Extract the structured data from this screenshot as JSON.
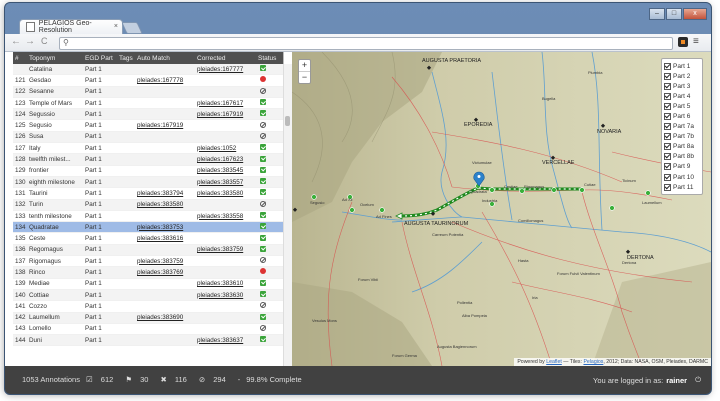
{
  "browser": {
    "tab_title": "PELAGIOS Geo-Resolution",
    "tab_close": "×",
    "back": "←",
    "forward": "→",
    "reload": "C",
    "min": "–",
    "max": "□",
    "close": "x",
    "menu": "≡"
  },
  "table": {
    "headers": [
      "#",
      "Toponym",
      "EGD Part",
      "Tags",
      "Auto Match",
      "Corrected",
      "Status"
    ],
    "rows": [
      {
        "num": "",
        "top": "Catalina",
        "egd": "Part 1",
        "auto": "",
        "corr": "pleiades:167777",
        "status": "ok",
        "style": "alt"
      },
      {
        "num": "121",
        "top": "Gesdao",
        "egd": "Part 1",
        "auto": "pleiades:167778",
        "corr": "",
        "status": "err",
        "style": ""
      },
      {
        "num": "122",
        "top": "Sesanne",
        "egd": "Part 1",
        "auto": "",
        "corr": "",
        "status": "no",
        "style": "alt"
      },
      {
        "num": "123",
        "top": "Temple of Mars",
        "egd": "Part 1",
        "auto": "",
        "corr": "pleiades:167617",
        "status": "ok",
        "style": ""
      },
      {
        "num": "124",
        "top": "Segussio",
        "egd": "Part 1",
        "auto": "",
        "corr": "pleiades:167919",
        "status": "ok",
        "style": "alt"
      },
      {
        "num": "125",
        "top": "Segusio",
        "egd": "Part 1",
        "auto": "pleiades:167919",
        "corr": "",
        "status": "no",
        "style": ""
      },
      {
        "num": "126",
        "top": "Susa",
        "egd": "Part 1",
        "auto": "",
        "corr": "",
        "status": "no",
        "style": "alt"
      },
      {
        "num": "127",
        "top": "Italy",
        "egd": "Part 1",
        "auto": "",
        "corr": "pleiades:1052",
        "status": "ok",
        "style": ""
      },
      {
        "num": "128",
        "top": "twelfth milest...",
        "egd": "Part 1",
        "auto": "",
        "corr": "pleiades:167623",
        "status": "ok",
        "style": "alt"
      },
      {
        "num": "129",
        "top": "frontier",
        "egd": "Part 1",
        "auto": "",
        "corr": "pleiades:383545",
        "status": "ok",
        "style": ""
      },
      {
        "num": "130",
        "top": "eighth milestone",
        "egd": "Part 1",
        "auto": "",
        "corr": "pleiades:383557",
        "status": "ok",
        "style": "alt"
      },
      {
        "num": "131",
        "top": "Taurini",
        "egd": "Part 1",
        "auto": "pleiades:383794",
        "corr": "pleiades:383580",
        "status": "ok",
        "style": ""
      },
      {
        "num": "132",
        "top": "Turin",
        "egd": "Part 1",
        "auto": "pleiades:383580",
        "corr": "",
        "status": "no",
        "style": "alt"
      },
      {
        "num": "133",
        "top": "tenth milestone",
        "egd": "Part 1",
        "auto": "",
        "corr": "pleiades:383558",
        "status": "ok",
        "style": ""
      },
      {
        "num": "134",
        "top": "Quadratae",
        "egd": "Part 1",
        "auto": "pleiades:383753",
        "corr": "",
        "status": "ok",
        "style": "sel"
      },
      {
        "num": "135",
        "top": "Ceste",
        "egd": "Part 1",
        "auto": "pleiades:383616",
        "corr": "",
        "status": "ok",
        "style": ""
      },
      {
        "num": "136",
        "top": "Regomagus",
        "egd": "Part 1",
        "auto": "",
        "corr": "pleiades:383759",
        "status": "ok",
        "style": "alt"
      },
      {
        "num": "137",
        "top": "Rigomagus",
        "egd": "Part 1",
        "auto": "pleiades:383759",
        "corr": "",
        "status": "no",
        "style": ""
      },
      {
        "num": "138",
        "top": "Rinco",
        "egd": "Part 1",
        "auto": "pleiades:383769",
        "corr": "",
        "status": "err",
        "style": "alt"
      },
      {
        "num": "139",
        "top": "Mediae",
        "egd": "Part 1",
        "auto": "",
        "corr": "pleiades:383610",
        "status": "ok",
        "style": ""
      },
      {
        "num": "140",
        "top": "Cottiae",
        "egd": "Part 1",
        "auto": "",
        "corr": "pleiades:383630",
        "status": "ok",
        "style": "alt"
      },
      {
        "num": "141",
        "top": "Cozzo",
        "egd": "Part 1",
        "auto": "",
        "corr": "",
        "status": "no",
        "style": ""
      },
      {
        "num": "142",
        "top": "Laumellum",
        "egd": "Part 1",
        "auto": "pleiades:383690",
        "corr": "",
        "status": "ok",
        "style": "alt"
      },
      {
        "num": "143",
        "top": "Lomello",
        "egd": "Part 1",
        "auto": "",
        "corr": "",
        "status": "no",
        "style": ""
      },
      {
        "num": "144",
        "top": "Duni",
        "egd": "Part 1",
        "auto": "",
        "corr": "pleiades:383637",
        "status": "ok",
        "style": "alt"
      }
    ]
  },
  "map": {
    "zoom_in": "+",
    "zoom_out": "−",
    "labels": [
      "AUGUSTA PRAETORIA",
      "EPOREDIA",
      "NOVARIA",
      "VERCELLAE",
      "AUGUSTA TAURINORUM",
      "DERTONA",
      "Ad Fines",
      "Quadrata",
      "Industria",
      "Rigomagus",
      "Cestiae",
      "Cutiae",
      "Carreum Potentia",
      "Forum Vibii",
      "Vesulus Mons",
      "Pollentia",
      "Hasta",
      "Plumbia",
      "Bugella",
      "Victumulae",
      "Laumellum",
      "Comillomagus",
      "Ad Xii",
      "Ocelum",
      "Segusio",
      "Forum Fulvii Valentinum",
      "Alba Pompeia",
      "Forum Germa",
      "Augusta Bagiennorum",
      "Dertona",
      "Iria",
      "Ticinum"
    ],
    "legend": [
      "Part 1",
      "Part 2",
      "Part 3",
      "Part 4",
      "Part 5",
      "Part 6",
      "Part 7a",
      "Part 7b",
      "Part 8a",
      "Part 8b",
      "Part 9",
      "Part 10",
      "Part 11"
    ],
    "attribution_pre": "Powered by",
    "attribution_link1": "Leaflet",
    "attribution_mid": "— Tiles:",
    "attribution_link2": "Pelagios",
    "attribution_post": ", 2012; Data: NASA, OSM, Pleiades, DARMC"
  },
  "statusbar": {
    "annotations": "1053 Annotations",
    "verified": "612",
    "flagged": "30",
    "not_identifiable": "116",
    "ignored": "294",
    "complete": "99.8% Complete",
    "login_prefix": "You are logged in as:",
    "user": "rainer",
    "logout_icon": "⏻"
  }
}
